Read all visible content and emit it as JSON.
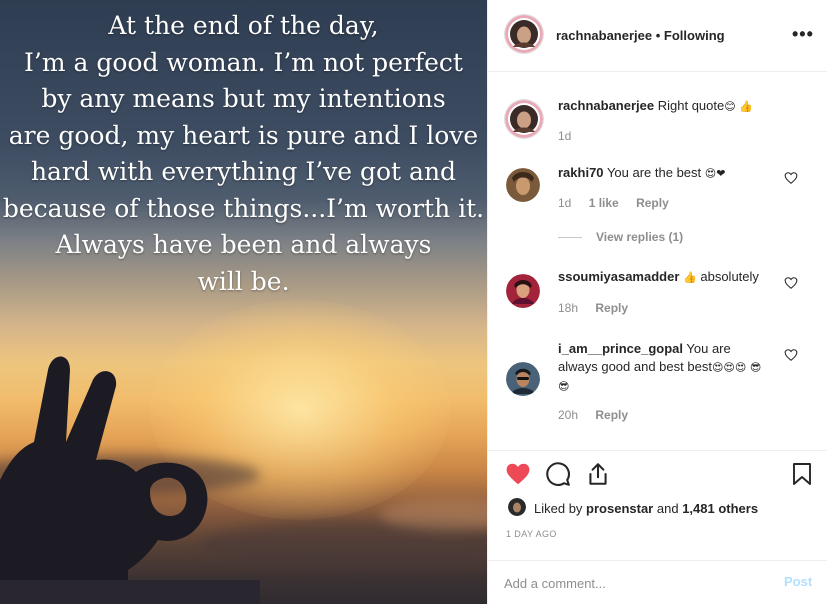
{
  "post": {
    "quote": "At the end of the day,\nI’m a good woman. I’m not perfect\nby any means but my intentions\nare good, my heart is pure and I love\nhard with everything I’ve got and\nbecause of those things...I’m worth it.\nAlways have been and always\nwill be."
  },
  "header": {
    "username": "rachnabanerjee",
    "separator": "•",
    "following": "Following",
    "more": "•••"
  },
  "comments": [
    {
      "username": "rachnabanerjee",
      "text": "Right quote",
      "emoji": "😊 👍",
      "time": "1d"
    },
    {
      "username": "rakhi70",
      "text": "You are the best",
      "emoji": "😍❤",
      "time": "1d",
      "likes": "1 like",
      "reply": "Reply",
      "view_replies": "View replies (1)"
    },
    {
      "username": "ssoumiyasamadder",
      "text": "absolutely",
      "emoji": "👍",
      "time": "18h",
      "reply": "Reply"
    },
    {
      "username": "i_am__prince_gopal",
      "text": "You are always good and best best",
      "emoji": "😍😍😍 😎😎",
      "time": "20h",
      "reply": "Reply"
    }
  ],
  "likes": {
    "prefix": "Liked by",
    "user": "prosenstar",
    "middle": "and",
    "others": "1,481 others"
  },
  "timestamp": "1 DAY AGO",
  "add_comment": {
    "placeholder": "Add a comment...",
    "post_label": "Post"
  },
  "colors": {
    "like_heart": "#ed4956",
    "post_button_disabled": "#b2dffc",
    "secondary_text": "#8e8e8e"
  },
  "icons": [
    "more-icon",
    "heart-icon",
    "comment-icon",
    "share-icon",
    "bookmark-icon"
  ]
}
